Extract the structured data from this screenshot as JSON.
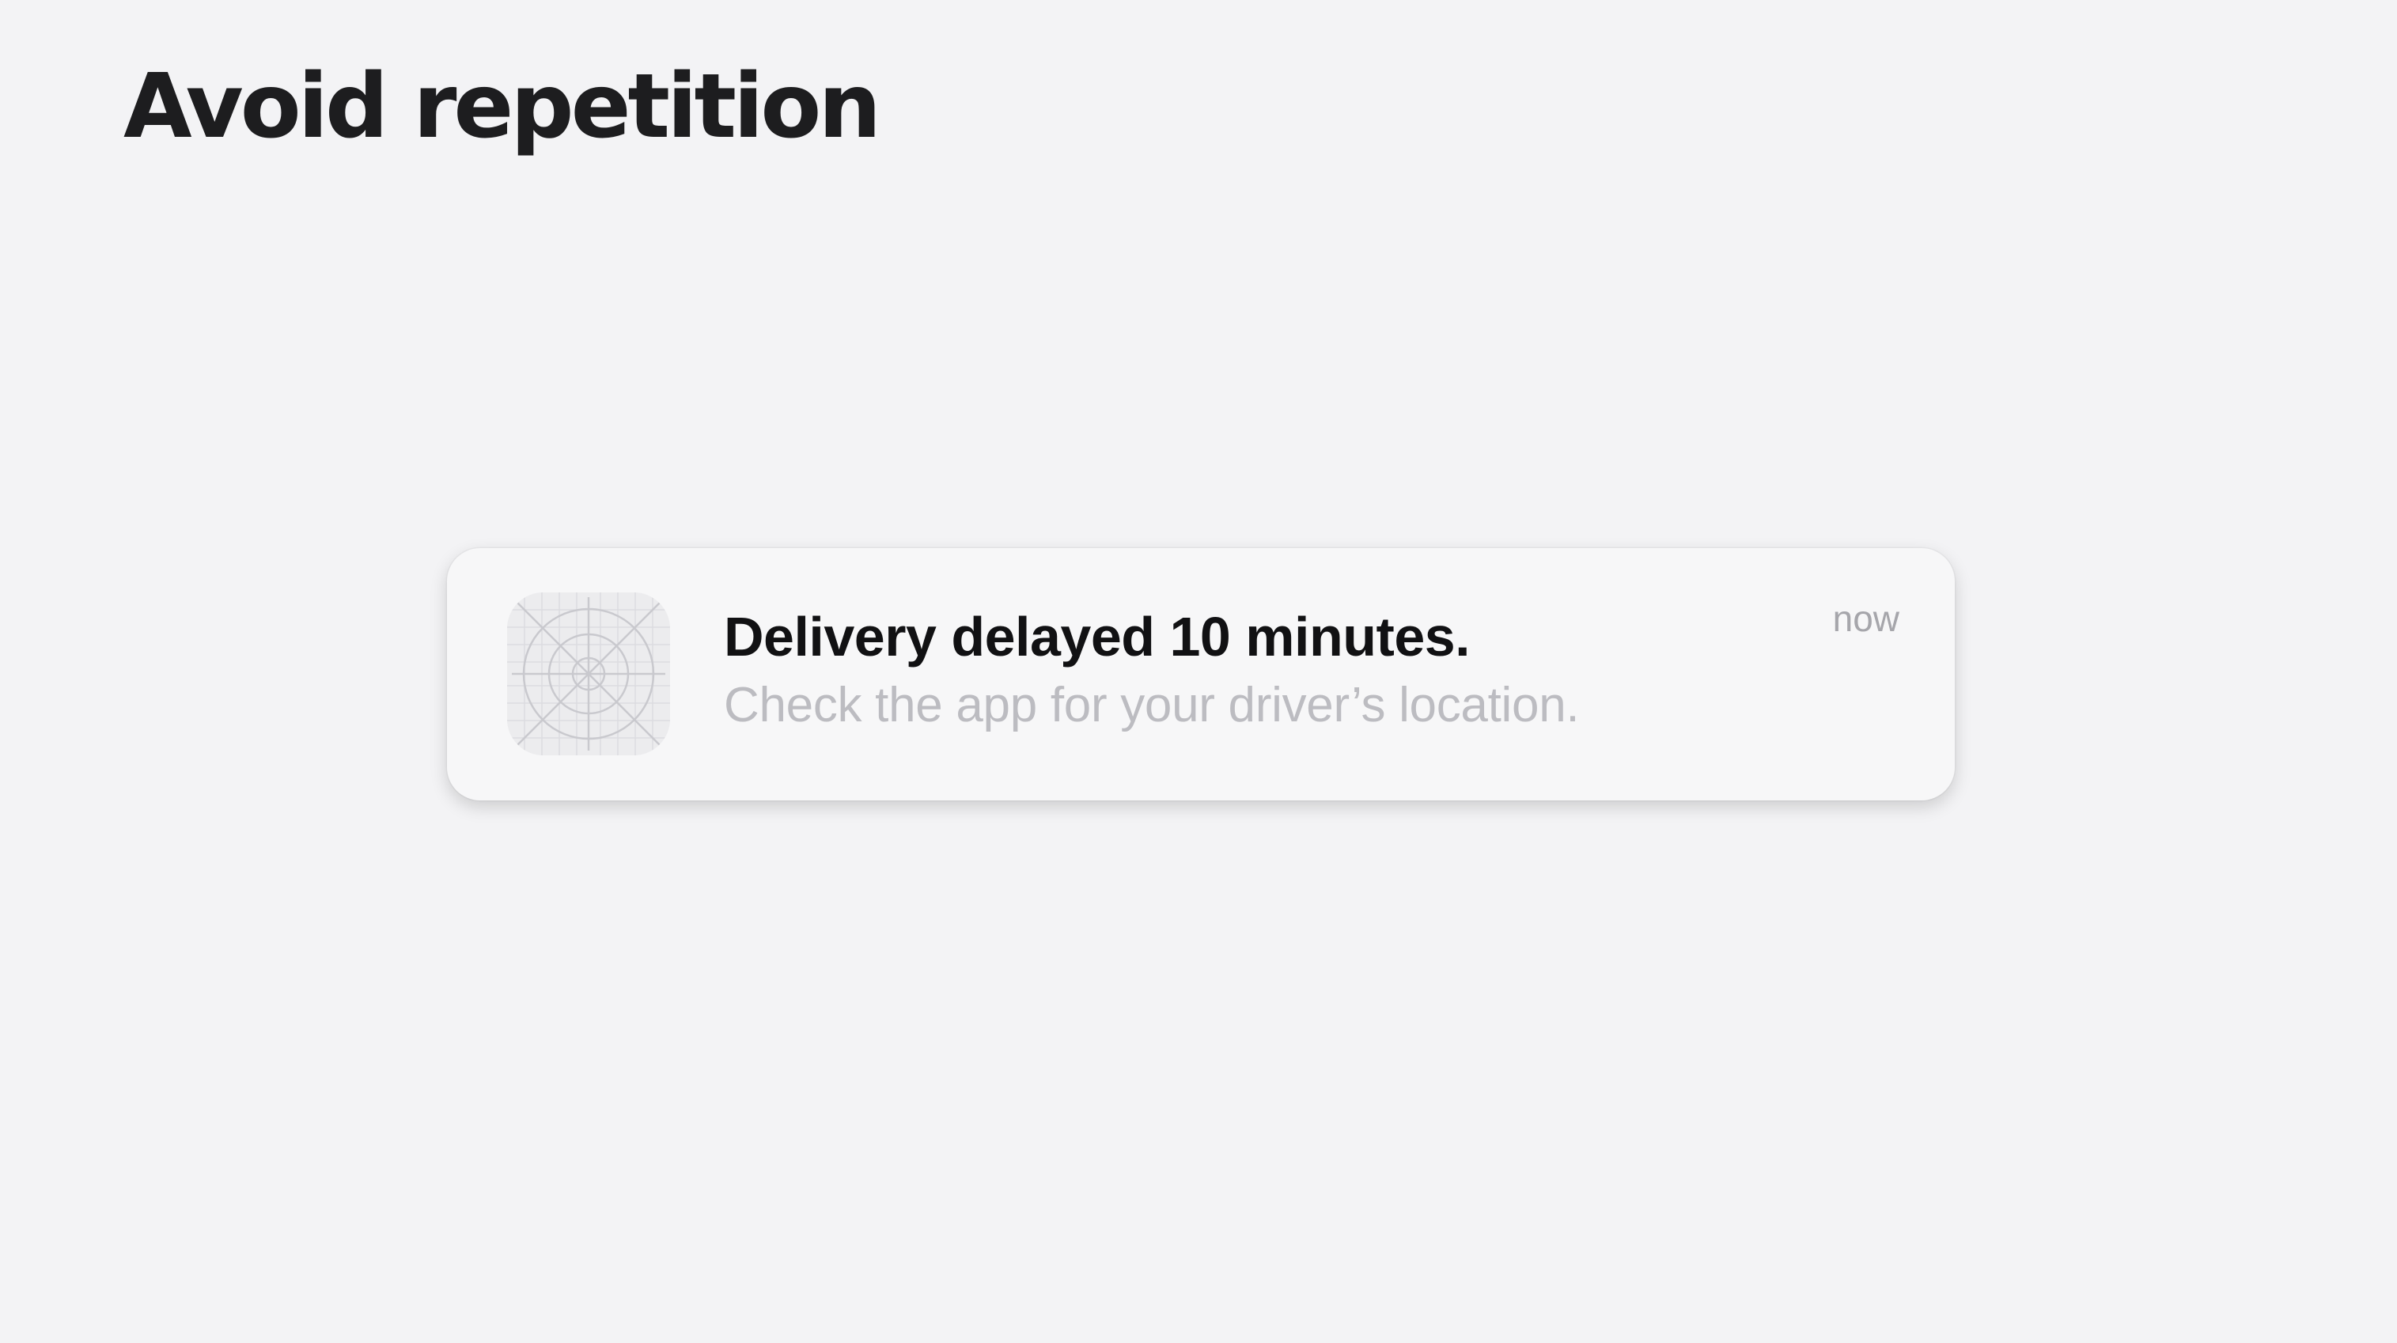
{
  "slide": {
    "title": "Avoid repetition"
  },
  "notification": {
    "app_icon": "placeholder-app-icon",
    "title": "Delivery delayed 10 minutes.",
    "body": "Check the app for your driver’s location.",
    "timestamp": "now"
  },
  "colors": {
    "background": "#f3f3f5",
    "card": "#f7f7f8",
    "title_text": "#1d1d1f",
    "notification_title": "#111113",
    "notification_body": "#bcbcc1",
    "timestamp": "#a6a6ab"
  }
}
